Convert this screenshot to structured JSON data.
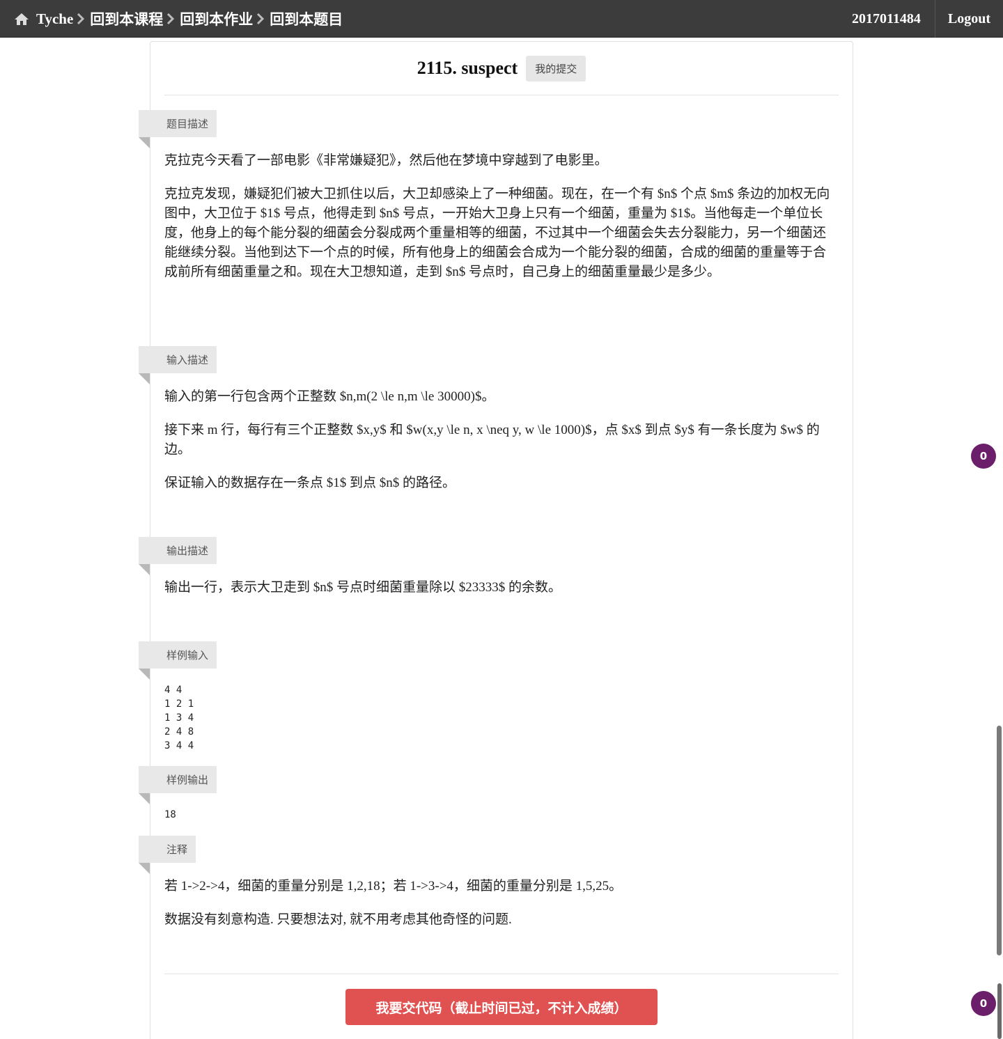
{
  "navbar": {
    "brand": "Tyche",
    "breadcrumbs": [
      "回到本课程",
      "回到本作业",
      "回到本题目"
    ],
    "user": "2017011484",
    "logout": "Logout"
  },
  "problem": {
    "title": "2115. suspect",
    "submissions_button": "我的提交"
  },
  "sections": {
    "description": {
      "label": "题目描述",
      "paragraphs": [
        "克拉克今天看了一部电影《非常嫌疑犯》，然后他在梦境中穿越到了电影里。",
        "克拉克发现，嫌疑犯们被大卫抓住以后，大卫却感染上了一种细菌。现在，在一个有 $n$ 个点 $m$ 条边的加权无向图中，大卫位于 $1$ 号点，他得走到 $n$ 号点，一开始大卫身上只有一个细菌，重量为 $1$。当他每走一个单位长度，他身上的每个能分裂的细菌会分裂成两个重量相等的细菌，不过其中一个细菌会失去分裂能力，另一个细菌还能继续分裂。当他到达下一个点的时候，所有他身上的细菌会合成为一个能分裂的细菌，合成的细菌的重量等于合成前所有细菌重量之和。现在大卫想知道，走到 $n$ 号点时，自己身上的细菌重量最少是多少。"
      ]
    },
    "input": {
      "label": "输入描述",
      "paragraphs": [
        "输入的第一行包含两个正整数 $n,m(2 \\le n,m \\le 30000)$。",
        "接下来 m 行，每行有三个正整数 $x,y$ 和 $w(x,y \\le n, x \\neq y, w \\le 1000)$，点 $x$ 到点 $y$ 有一条长度为 $w$ 的边。",
        "保证输入的数据存在一条点 $1$ 到点 $n$ 的路径。"
      ]
    },
    "output": {
      "label": "输出描述",
      "paragraphs": [
        "输出一行，表示大卫走到 $n$ 号点时细菌重量除以 $23333$ 的余数。"
      ]
    },
    "sample_input": {
      "label": "样例输入",
      "code": "4 4\n1 2 1\n1 3 4\n2 4 8\n3 4 4"
    },
    "sample_output": {
      "label": "样例输出",
      "code": "18"
    },
    "notes": {
      "label": "注释",
      "paragraphs": [
        "若 1->2->4，细菌的重量分别是 1,2,18；若 1->3->4，细菌的重量分别是 1,5,25。",
        "数据没有刻意构造. 只要想法对, 就不用考虑其他奇怪的问题."
      ]
    }
  },
  "submit_button": "我要交代码（截止时间已过，不计入成绩）",
  "badges": [
    "0",
    "0"
  ],
  "icons": {
    "home": "home-icon",
    "breadcrumb_separator": "chevron-right-icon"
  },
  "colors": {
    "navbar": "#3c3c3c",
    "submit": "#e05252",
    "badge": "#6b1f6b",
    "ribbon": "#e8e8e8"
  }
}
